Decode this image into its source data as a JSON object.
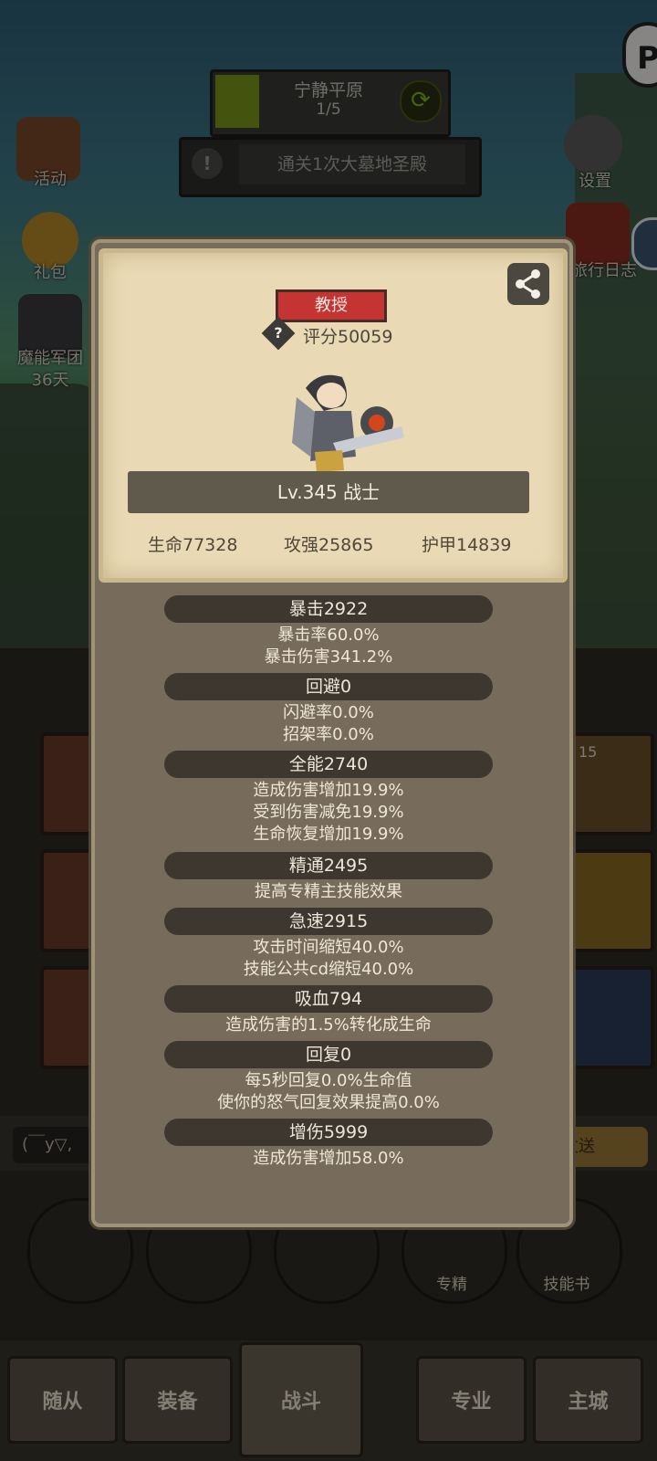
{
  "hud": {
    "stage_name": "宁静平原",
    "stage_progress": "1/5",
    "quest": "通关1次大墓地圣殿",
    "left_icons": [
      {
        "label": "活动",
        "icon": "scroll-icon"
      },
      {
        "label": "礼包",
        "icon": "gift-coin-icon"
      },
      {
        "label": "魔能军团",
        "sub": "36天",
        "icon": "legion-icon"
      }
    ],
    "right_icons": [
      {
        "label": "设置",
        "icon": "gear-icon"
      },
      {
        "label": "旅行日志",
        "icon": "book-icon"
      }
    ]
  },
  "bottom": {
    "chat_placeholder": "(￣y▽,",
    "send_label": "发送",
    "slot_badge": "15",
    "actions": [
      "专精",
      "技能书"
    ],
    "tabs": [
      "随从",
      "装备",
      "战斗",
      "专业",
      "主城"
    ]
  },
  "profile": {
    "title_badge": "教授",
    "score": "评分50059",
    "level_class": "Lv.345 战士",
    "base_stats": [
      "生命77328",
      "攻强25865",
      "护甲14839"
    ]
  },
  "attributes": [
    {
      "name": "暴击2922",
      "details": [
        "暴击率60.0%",
        "暴击伤害341.2%"
      ]
    },
    {
      "name": "回避0",
      "details": [
        "闪避率0.0%",
        "招架率0.0%"
      ]
    },
    {
      "name": "全能2740",
      "details": [
        "造成伤害增加19.9%",
        "受到伤害减免19.9%",
        "生命恢复增加19.9%"
      ]
    },
    {
      "name": "精通2495",
      "details": [
        "提高专精主技能效果"
      ]
    },
    {
      "name": "急速2915",
      "details": [
        "攻击时间缩短40.0%",
        "技能公共cd缩短40.0%"
      ]
    },
    {
      "name": "吸血794",
      "details": [
        "造成伤害的1.5%转化成生命"
      ]
    },
    {
      "name": "回复0",
      "details": [
        "每5秒回复0.0%生命值",
        "使你的怒气回复效果提高0.0%"
      ]
    },
    {
      "name": "增伤5999",
      "details": [
        "造成伤害增加58.0%"
      ]
    }
  ],
  "colors": {
    "modal_body": "#776b5b",
    "card_paper": "#e9dab5",
    "title_badge": "#c43433",
    "pill": "#3d3730"
  }
}
